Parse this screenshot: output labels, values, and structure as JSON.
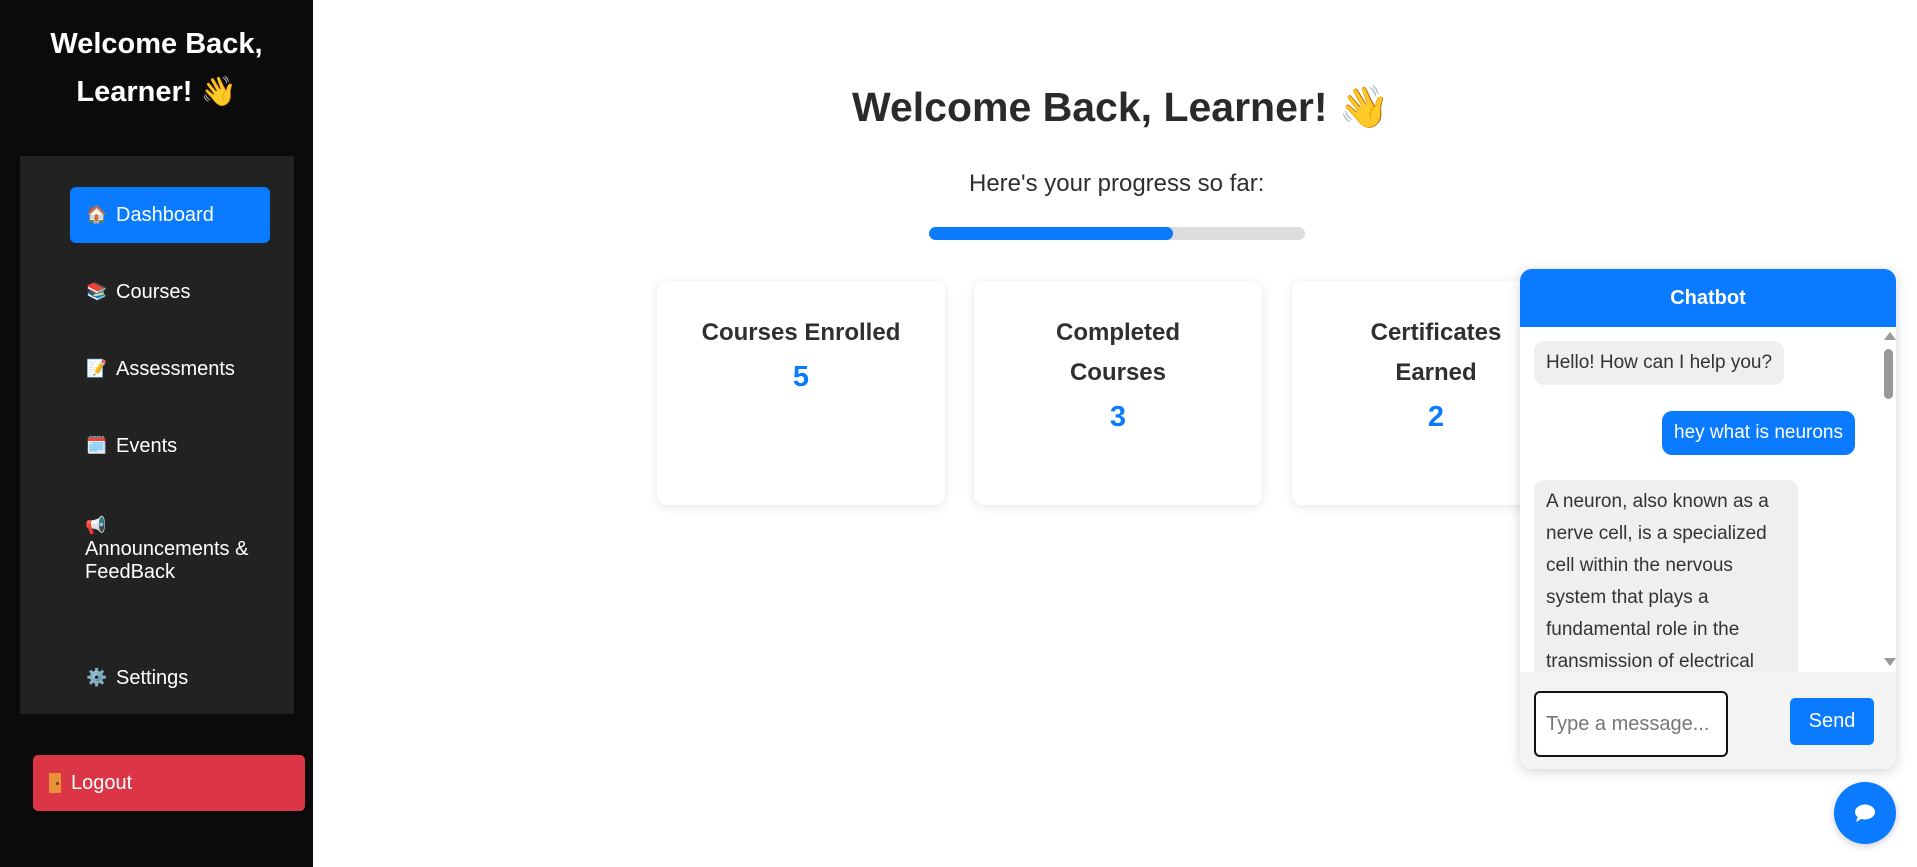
{
  "sidebar": {
    "title_line1": "Welcome Back,",
    "title_line2": "Learner! 👋",
    "items": [
      {
        "label": "Dashboard",
        "icon": "🏠",
        "icon_name": "house-icon"
      },
      {
        "label": "Courses",
        "icon": "📚",
        "icon_name": "books-icon"
      },
      {
        "label": "Assessments",
        "icon": "📝",
        "icon_name": "memo-icon"
      },
      {
        "label": "Events",
        "icon": "🗓️",
        "icon_name": "calendar-icon"
      },
      {
        "label_line1": "Announcements &",
        "label_line2": "FeedBack",
        "icon": "📢",
        "icon_name": "megaphone-icon"
      },
      {
        "label": "Settings",
        "icon": "⚙️",
        "icon_name": "gear-icon"
      }
    ],
    "logout_label": "Logout"
  },
  "main": {
    "title": "Welcome Back, Learner! 👋",
    "subtitle": "Here's your progress so far:",
    "progress_percent": 65,
    "cards": [
      {
        "title": "Courses Enrolled",
        "value": "5"
      },
      {
        "title": "Completed Courses",
        "value": "3"
      },
      {
        "title": "Certificates Earned",
        "value": "2"
      }
    ]
  },
  "chatbot": {
    "title": "Chatbot",
    "messages": [
      {
        "role": "bot",
        "text": "Hello! How can I help you?"
      },
      {
        "role": "user",
        "text": "hey what is neurons"
      },
      {
        "role": "bot",
        "text": "A neuron, also known as a nerve cell, is a specialized cell within the nervous system that plays a fundamental role in the transmission of electrical"
      }
    ],
    "input_placeholder": "Type a message...",
    "send_label": "Send"
  },
  "colors": {
    "accent": "#0a7bff",
    "danger": "#dc3545",
    "sidebar_bg": "#0b0b0b",
    "nav_panel_bg": "#222222"
  }
}
